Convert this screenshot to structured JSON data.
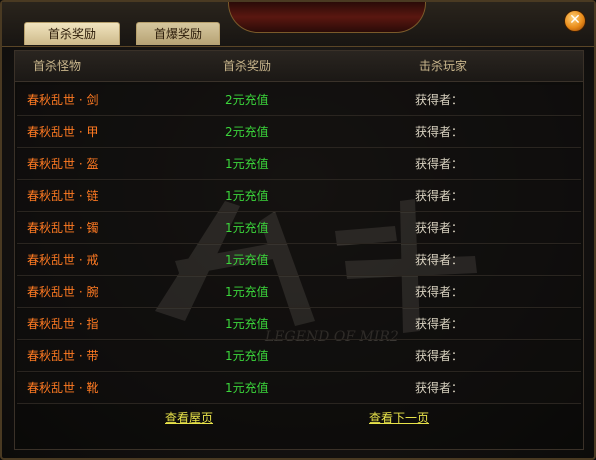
{
  "tabs": [
    {
      "label": "首杀奖励"
    },
    {
      "label": "首爆奖励"
    }
  ],
  "close_icon": "close-icon",
  "table": {
    "headers": [
      "首杀怪物",
      "首杀奖励",
      "击杀玩家"
    ],
    "rows": [
      {
        "monster": "春秋乱世 · 剑",
        "reward": "2元充值",
        "player": "获得者："
      },
      {
        "monster": "春秋乱世 · 甲",
        "reward": "2元充值",
        "player": "获得者："
      },
      {
        "monster": "春秋乱世 · 盔",
        "reward": "1元充值",
        "player": "获得者："
      },
      {
        "monster": "春秋乱世 · 链",
        "reward": "1元充值",
        "player": "获得者："
      },
      {
        "monster": "春秋乱世 · 镯",
        "reward": "1元充值",
        "player": "获得者："
      },
      {
        "monster": "春秋乱世 · 戒",
        "reward": "1元充值",
        "player": "获得者："
      },
      {
        "monster": "春秋乱世 · 腕",
        "reward": "1元充值",
        "player": "获得者："
      },
      {
        "monster": "春秋乱世 · 指",
        "reward": "1元充值",
        "player": "获得者："
      },
      {
        "monster": "春秋乱世 · 带",
        "reward": "1元充值",
        "player": "获得者："
      },
      {
        "monster": "春秋乱世 · 靴",
        "reward": "1元充值",
        "player": "获得者："
      }
    ]
  },
  "footer": {
    "first_page": "查看屋页",
    "next_page": "查看下一页"
  },
  "watermark": {
    "text": "LEGEND OF MIR2"
  },
  "colors": {
    "monster": "#ff7a22",
    "reward": "#3bd63b",
    "player": "#d9d2c0",
    "link": "#e8e34a",
    "header": "#c9b68c"
  }
}
